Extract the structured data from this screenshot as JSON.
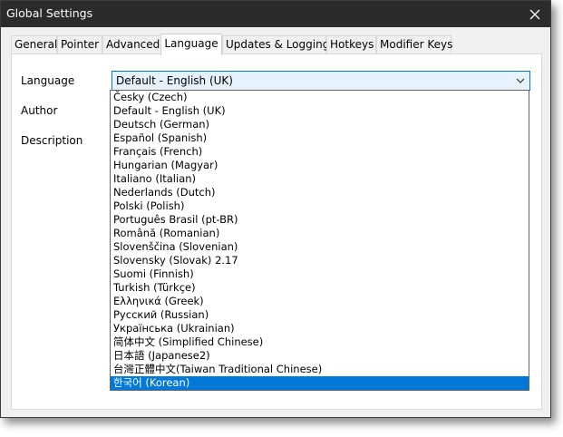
{
  "window": {
    "title": "Global Settings"
  },
  "tabs": [
    {
      "label": "General"
    },
    {
      "label": "Pointer"
    },
    {
      "label": "Advanced"
    },
    {
      "label": "Language"
    },
    {
      "label": "Updates & Logging"
    },
    {
      "label": "Hotkeys"
    },
    {
      "label": "Modifier Keys"
    }
  ],
  "active_tab": "Language",
  "form": {
    "language_label": "Language",
    "author_label": "Author",
    "description_label": "Description",
    "language_value": "Default - English (UK)"
  },
  "dropdown": {
    "items": [
      "Česky (Czech)",
      "Default - English (UK)",
      "Deutsch (German)",
      "Español (Spanish)",
      "Français (French)",
      "Hungarian (Magyar)",
      "Italiano (Italian)",
      "Nederlands (Dutch)",
      "Polski (Polish)",
      "Português Brasil (pt-BR)",
      "Română (Romanian)",
      "Slovenščina (Slovenian)",
      "Slovensky (Slovak) 2.17",
      "Suomi (Finnish)",
      "Turkish (Türkçe)",
      "Ελληνικά (Greek)",
      "Русский (Russian)",
      "Українська (Ukrainian)",
      "简体中文 (Simplified Chinese)",
      "日本語 (Japanese2)",
      "台灣正體中文(Taiwan Traditional Chinese)",
      "한국어 (Korean)"
    ],
    "highlighted": "한국어 (Korean)"
  },
  "colors": {
    "titlebar": "#2b2b2b",
    "accent": "#0078d7",
    "select_background": "#e5f1fb"
  },
  "icons": {
    "close": "close-icon",
    "dropdown_arrow": "chevron-down-icon"
  }
}
